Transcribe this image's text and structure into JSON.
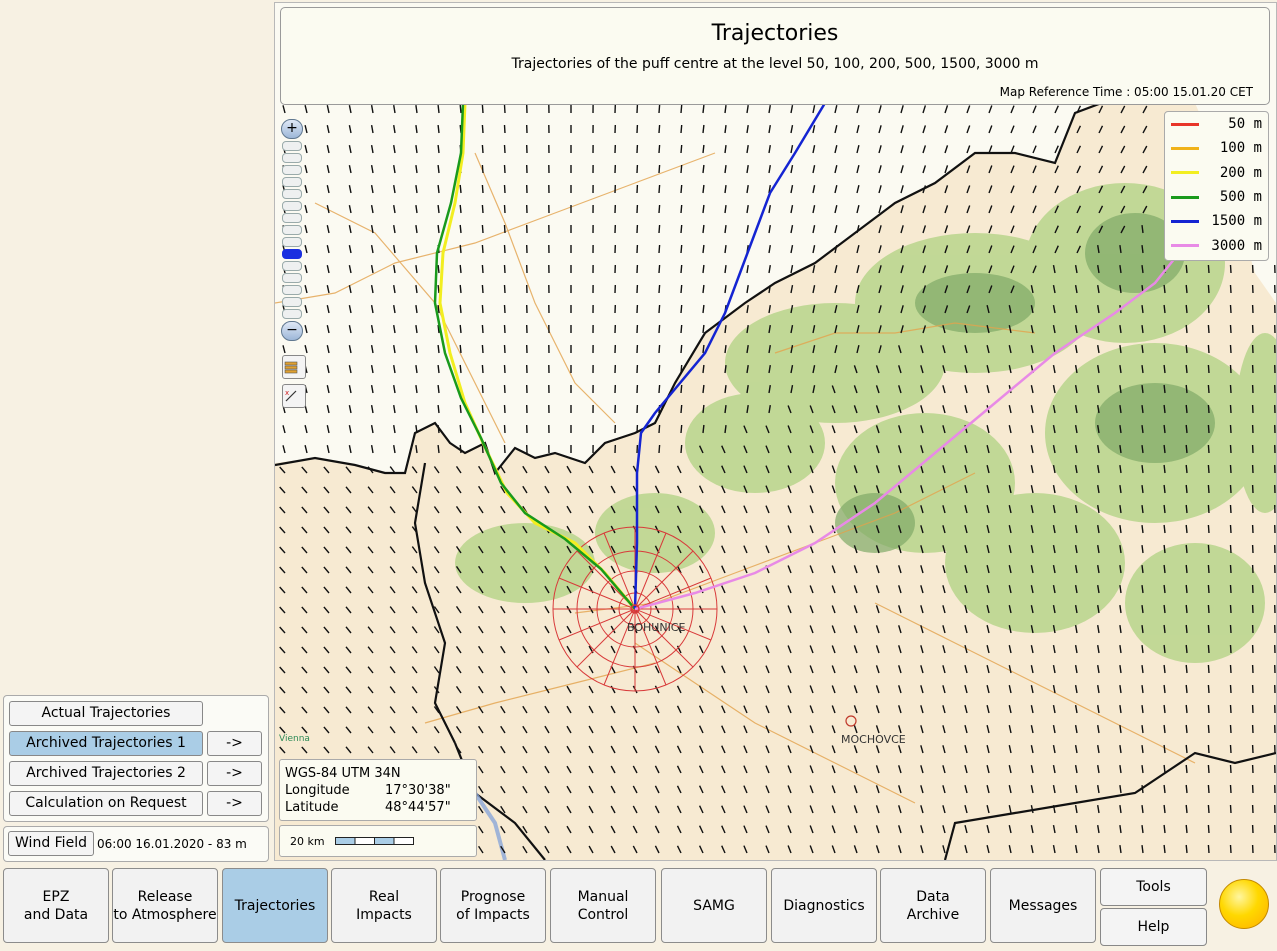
{
  "map": {
    "title": "Trajectories",
    "subtitle": "Trajectories of the puff centre at the level 50, 100, 200, 500, 1500, 3000 m",
    "reference_time": "Map Reference Time : 05:00 15.01.20 CET",
    "legend": [
      {
        "label": "50 m",
        "color": "#e8352a"
      },
      {
        "label": "100 m",
        "color": "#f0b21a"
      },
      {
        "label": "200 m",
        "color": "#f2ee20"
      },
      {
        "label": "500 m",
        "color": "#199a1c"
      },
      {
        "label": "1500 m",
        "color": "#1424d2"
      },
      {
        "label": "3000 m",
        "color": "#e88ae6"
      }
    ],
    "places": {
      "bohunice": "BOHUNICE",
      "mochovce": "MOCHOVCE",
      "vienna": "Vienna"
    },
    "zoom_level_index": 9,
    "zoom_plus": "+",
    "zoom_minus": "−",
    "coords": {
      "system": "WGS-84 UTM 34N",
      "longitude_label": "Longitude",
      "longitude_value": "17°30'38\"",
      "latitude_label": "Latitude",
      "latitude_value": "48°44'57\""
    },
    "scale_label": "20 km"
  },
  "trajectory_panel": {
    "actual": "Actual Trajectories",
    "archived1": "Archived Trajectories 1",
    "archived2": "Archived Trajectories 2",
    "calc": "Calculation on Request",
    "arrow": "->"
  },
  "wind": {
    "button": "Wind Field",
    "value": "06:00 16.01.2020 - 83 m"
  },
  "nav": [
    {
      "line1": "EPZ",
      "line2": "and Data"
    },
    {
      "line1": "Release",
      "line2": "to Atmosphere"
    },
    {
      "line1": "Trajectories",
      "line2": ""
    },
    {
      "line1": "Real",
      "line2": "Impacts"
    },
    {
      "line1": "Prognose",
      "line2": "of Impacts"
    },
    {
      "line1": "Manual",
      "line2": "Control"
    },
    {
      "line1": "SAMG",
      "line2": ""
    },
    {
      "line1": "Diagnostics",
      "line2": ""
    },
    {
      "line1": "Data",
      "line2": "Archive"
    },
    {
      "line1": "Messages",
      "line2": ""
    }
  ],
  "tools": "Tools",
  "help": "Help",
  "status_color": "#ffd800"
}
